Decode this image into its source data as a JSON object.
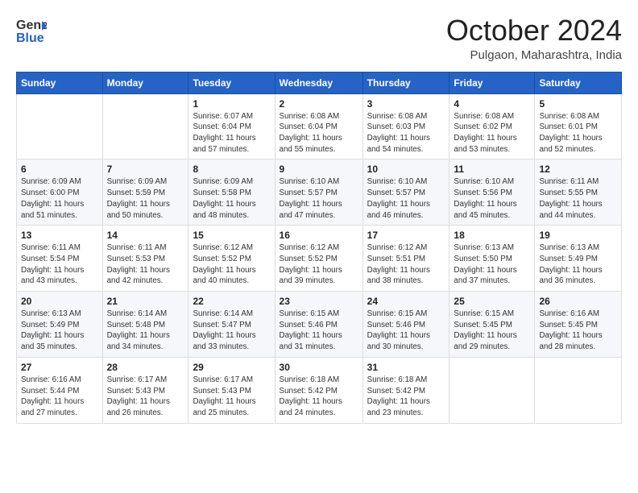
{
  "logo": {
    "line1": "General",
    "line2": "Blue"
  },
  "title": "October 2024",
  "location": "Pulgaon, Maharashtra, India",
  "weekdays": [
    "Sunday",
    "Monday",
    "Tuesday",
    "Wednesday",
    "Thursday",
    "Friday",
    "Saturday"
  ],
  "weeks": [
    [
      {
        "day": "",
        "info": ""
      },
      {
        "day": "",
        "info": ""
      },
      {
        "day": "1",
        "info": "Sunrise: 6:07 AM\nSunset: 6:04 PM\nDaylight: 11 hours\nand 57 minutes."
      },
      {
        "day": "2",
        "info": "Sunrise: 6:08 AM\nSunset: 6:04 PM\nDaylight: 11 hours\nand 55 minutes."
      },
      {
        "day": "3",
        "info": "Sunrise: 6:08 AM\nSunset: 6:03 PM\nDaylight: 11 hours\nand 54 minutes."
      },
      {
        "day": "4",
        "info": "Sunrise: 6:08 AM\nSunset: 6:02 PM\nDaylight: 11 hours\nand 53 minutes."
      },
      {
        "day": "5",
        "info": "Sunrise: 6:08 AM\nSunset: 6:01 PM\nDaylight: 11 hours\nand 52 minutes."
      }
    ],
    [
      {
        "day": "6",
        "info": "Sunrise: 6:09 AM\nSunset: 6:00 PM\nDaylight: 11 hours\nand 51 minutes."
      },
      {
        "day": "7",
        "info": "Sunrise: 6:09 AM\nSunset: 5:59 PM\nDaylight: 11 hours\nand 50 minutes."
      },
      {
        "day": "8",
        "info": "Sunrise: 6:09 AM\nSunset: 5:58 PM\nDaylight: 11 hours\nand 48 minutes."
      },
      {
        "day": "9",
        "info": "Sunrise: 6:10 AM\nSunset: 5:57 PM\nDaylight: 11 hours\nand 47 minutes."
      },
      {
        "day": "10",
        "info": "Sunrise: 6:10 AM\nSunset: 5:57 PM\nDaylight: 11 hours\nand 46 minutes."
      },
      {
        "day": "11",
        "info": "Sunrise: 6:10 AM\nSunset: 5:56 PM\nDaylight: 11 hours\nand 45 minutes."
      },
      {
        "day": "12",
        "info": "Sunrise: 6:11 AM\nSunset: 5:55 PM\nDaylight: 11 hours\nand 44 minutes."
      }
    ],
    [
      {
        "day": "13",
        "info": "Sunrise: 6:11 AM\nSunset: 5:54 PM\nDaylight: 11 hours\nand 43 minutes."
      },
      {
        "day": "14",
        "info": "Sunrise: 6:11 AM\nSunset: 5:53 PM\nDaylight: 11 hours\nand 42 minutes."
      },
      {
        "day": "15",
        "info": "Sunrise: 6:12 AM\nSunset: 5:52 PM\nDaylight: 11 hours\nand 40 minutes."
      },
      {
        "day": "16",
        "info": "Sunrise: 6:12 AM\nSunset: 5:52 PM\nDaylight: 11 hours\nand 39 minutes."
      },
      {
        "day": "17",
        "info": "Sunrise: 6:12 AM\nSunset: 5:51 PM\nDaylight: 11 hours\nand 38 minutes."
      },
      {
        "day": "18",
        "info": "Sunrise: 6:13 AM\nSunset: 5:50 PM\nDaylight: 11 hours\nand 37 minutes."
      },
      {
        "day": "19",
        "info": "Sunrise: 6:13 AM\nSunset: 5:49 PM\nDaylight: 11 hours\nand 36 minutes."
      }
    ],
    [
      {
        "day": "20",
        "info": "Sunrise: 6:13 AM\nSunset: 5:49 PM\nDaylight: 11 hours\nand 35 minutes."
      },
      {
        "day": "21",
        "info": "Sunrise: 6:14 AM\nSunset: 5:48 PM\nDaylight: 11 hours\nand 34 minutes."
      },
      {
        "day": "22",
        "info": "Sunrise: 6:14 AM\nSunset: 5:47 PM\nDaylight: 11 hours\nand 33 minutes."
      },
      {
        "day": "23",
        "info": "Sunrise: 6:15 AM\nSunset: 5:46 PM\nDaylight: 11 hours\nand 31 minutes."
      },
      {
        "day": "24",
        "info": "Sunrise: 6:15 AM\nSunset: 5:46 PM\nDaylight: 11 hours\nand 30 minutes."
      },
      {
        "day": "25",
        "info": "Sunrise: 6:15 AM\nSunset: 5:45 PM\nDaylight: 11 hours\nand 29 minutes."
      },
      {
        "day": "26",
        "info": "Sunrise: 6:16 AM\nSunset: 5:45 PM\nDaylight: 11 hours\nand 28 minutes."
      }
    ],
    [
      {
        "day": "27",
        "info": "Sunrise: 6:16 AM\nSunset: 5:44 PM\nDaylight: 11 hours\nand 27 minutes."
      },
      {
        "day": "28",
        "info": "Sunrise: 6:17 AM\nSunset: 5:43 PM\nDaylight: 11 hours\nand 26 minutes."
      },
      {
        "day": "29",
        "info": "Sunrise: 6:17 AM\nSunset: 5:43 PM\nDaylight: 11 hours\nand 25 minutes."
      },
      {
        "day": "30",
        "info": "Sunrise: 6:18 AM\nSunset: 5:42 PM\nDaylight: 11 hours\nand 24 minutes."
      },
      {
        "day": "31",
        "info": "Sunrise: 6:18 AM\nSunset: 5:42 PM\nDaylight: 11 hours\nand 23 minutes."
      },
      {
        "day": "",
        "info": ""
      },
      {
        "day": "",
        "info": ""
      }
    ]
  ]
}
